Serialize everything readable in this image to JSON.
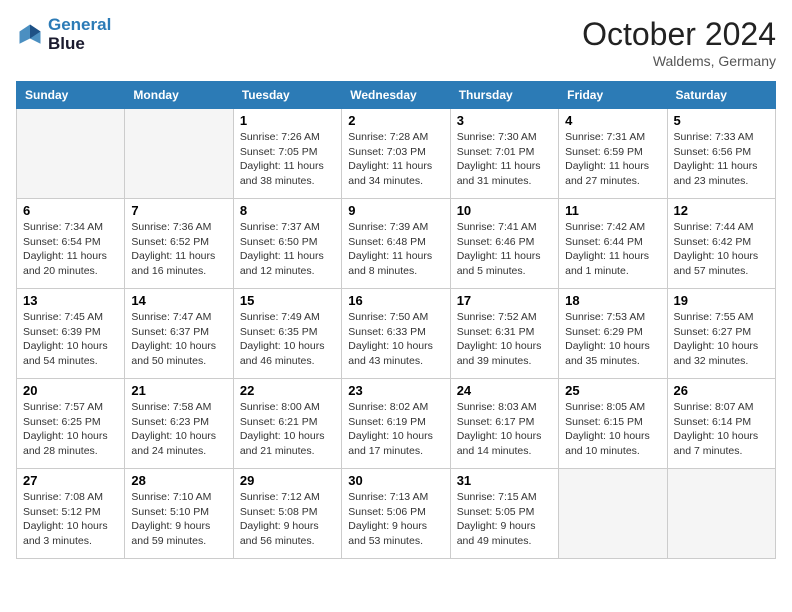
{
  "header": {
    "logo_line1": "General",
    "logo_line2": "Blue",
    "month": "October 2024",
    "location": "Waldems, Germany"
  },
  "days_of_week": [
    "Sunday",
    "Monday",
    "Tuesday",
    "Wednesday",
    "Thursday",
    "Friday",
    "Saturday"
  ],
  "weeks": [
    [
      {
        "day": "",
        "empty": true
      },
      {
        "day": "",
        "empty": true
      },
      {
        "day": "1",
        "sunrise": "Sunrise: 7:26 AM",
        "sunset": "Sunset: 7:05 PM",
        "daylight": "Daylight: 11 hours and 38 minutes."
      },
      {
        "day": "2",
        "sunrise": "Sunrise: 7:28 AM",
        "sunset": "Sunset: 7:03 PM",
        "daylight": "Daylight: 11 hours and 34 minutes."
      },
      {
        "day": "3",
        "sunrise": "Sunrise: 7:30 AM",
        "sunset": "Sunset: 7:01 PM",
        "daylight": "Daylight: 11 hours and 31 minutes."
      },
      {
        "day": "4",
        "sunrise": "Sunrise: 7:31 AM",
        "sunset": "Sunset: 6:59 PM",
        "daylight": "Daylight: 11 hours and 27 minutes."
      },
      {
        "day": "5",
        "sunrise": "Sunrise: 7:33 AM",
        "sunset": "Sunset: 6:56 PM",
        "daylight": "Daylight: 11 hours and 23 minutes."
      }
    ],
    [
      {
        "day": "6",
        "sunrise": "Sunrise: 7:34 AM",
        "sunset": "Sunset: 6:54 PM",
        "daylight": "Daylight: 11 hours and 20 minutes."
      },
      {
        "day": "7",
        "sunrise": "Sunrise: 7:36 AM",
        "sunset": "Sunset: 6:52 PM",
        "daylight": "Daylight: 11 hours and 16 minutes."
      },
      {
        "day": "8",
        "sunrise": "Sunrise: 7:37 AM",
        "sunset": "Sunset: 6:50 PM",
        "daylight": "Daylight: 11 hours and 12 minutes."
      },
      {
        "day": "9",
        "sunrise": "Sunrise: 7:39 AM",
        "sunset": "Sunset: 6:48 PM",
        "daylight": "Daylight: 11 hours and 8 minutes."
      },
      {
        "day": "10",
        "sunrise": "Sunrise: 7:41 AM",
        "sunset": "Sunset: 6:46 PM",
        "daylight": "Daylight: 11 hours and 5 minutes."
      },
      {
        "day": "11",
        "sunrise": "Sunrise: 7:42 AM",
        "sunset": "Sunset: 6:44 PM",
        "daylight": "Daylight: 11 hours and 1 minute."
      },
      {
        "day": "12",
        "sunrise": "Sunrise: 7:44 AM",
        "sunset": "Sunset: 6:42 PM",
        "daylight": "Daylight: 10 hours and 57 minutes."
      }
    ],
    [
      {
        "day": "13",
        "sunrise": "Sunrise: 7:45 AM",
        "sunset": "Sunset: 6:39 PM",
        "daylight": "Daylight: 10 hours and 54 minutes."
      },
      {
        "day": "14",
        "sunrise": "Sunrise: 7:47 AM",
        "sunset": "Sunset: 6:37 PM",
        "daylight": "Daylight: 10 hours and 50 minutes."
      },
      {
        "day": "15",
        "sunrise": "Sunrise: 7:49 AM",
        "sunset": "Sunset: 6:35 PM",
        "daylight": "Daylight: 10 hours and 46 minutes."
      },
      {
        "day": "16",
        "sunrise": "Sunrise: 7:50 AM",
        "sunset": "Sunset: 6:33 PM",
        "daylight": "Daylight: 10 hours and 43 minutes."
      },
      {
        "day": "17",
        "sunrise": "Sunrise: 7:52 AM",
        "sunset": "Sunset: 6:31 PM",
        "daylight": "Daylight: 10 hours and 39 minutes."
      },
      {
        "day": "18",
        "sunrise": "Sunrise: 7:53 AM",
        "sunset": "Sunset: 6:29 PM",
        "daylight": "Daylight: 10 hours and 35 minutes."
      },
      {
        "day": "19",
        "sunrise": "Sunrise: 7:55 AM",
        "sunset": "Sunset: 6:27 PM",
        "daylight": "Daylight: 10 hours and 32 minutes."
      }
    ],
    [
      {
        "day": "20",
        "sunrise": "Sunrise: 7:57 AM",
        "sunset": "Sunset: 6:25 PM",
        "daylight": "Daylight: 10 hours and 28 minutes."
      },
      {
        "day": "21",
        "sunrise": "Sunrise: 7:58 AM",
        "sunset": "Sunset: 6:23 PM",
        "daylight": "Daylight: 10 hours and 24 minutes."
      },
      {
        "day": "22",
        "sunrise": "Sunrise: 8:00 AM",
        "sunset": "Sunset: 6:21 PM",
        "daylight": "Daylight: 10 hours and 21 minutes."
      },
      {
        "day": "23",
        "sunrise": "Sunrise: 8:02 AM",
        "sunset": "Sunset: 6:19 PM",
        "daylight": "Daylight: 10 hours and 17 minutes."
      },
      {
        "day": "24",
        "sunrise": "Sunrise: 8:03 AM",
        "sunset": "Sunset: 6:17 PM",
        "daylight": "Daylight: 10 hours and 14 minutes."
      },
      {
        "day": "25",
        "sunrise": "Sunrise: 8:05 AM",
        "sunset": "Sunset: 6:15 PM",
        "daylight": "Daylight: 10 hours and 10 minutes."
      },
      {
        "day": "26",
        "sunrise": "Sunrise: 8:07 AM",
        "sunset": "Sunset: 6:14 PM",
        "daylight": "Daylight: 10 hours and 7 minutes."
      }
    ],
    [
      {
        "day": "27",
        "sunrise": "Sunrise: 7:08 AM",
        "sunset": "Sunset: 5:12 PM",
        "daylight": "Daylight: 10 hours and 3 minutes."
      },
      {
        "day": "28",
        "sunrise": "Sunrise: 7:10 AM",
        "sunset": "Sunset: 5:10 PM",
        "daylight": "Daylight: 9 hours and 59 minutes."
      },
      {
        "day": "29",
        "sunrise": "Sunrise: 7:12 AM",
        "sunset": "Sunset: 5:08 PM",
        "daylight": "Daylight: 9 hours and 56 minutes."
      },
      {
        "day": "30",
        "sunrise": "Sunrise: 7:13 AM",
        "sunset": "Sunset: 5:06 PM",
        "daylight": "Daylight: 9 hours and 53 minutes."
      },
      {
        "day": "31",
        "sunrise": "Sunrise: 7:15 AM",
        "sunset": "Sunset: 5:05 PM",
        "daylight": "Daylight: 9 hours and 49 minutes."
      },
      {
        "day": "",
        "empty": true
      },
      {
        "day": "",
        "empty": true
      }
    ]
  ]
}
